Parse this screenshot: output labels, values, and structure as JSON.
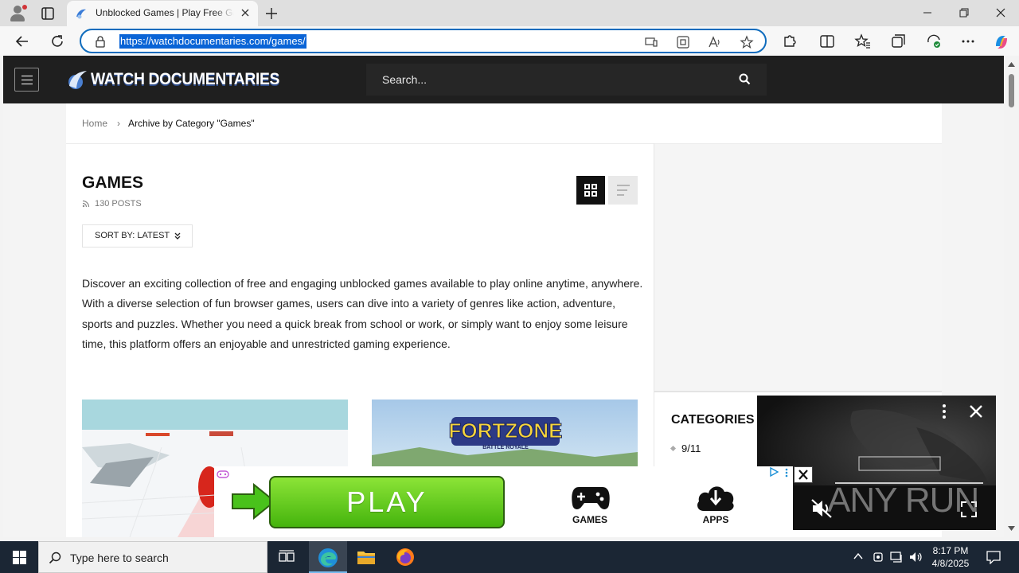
{
  "browser": {
    "tab_title": "Unblocked Games | Play Free Games",
    "url": "https://watchdocumentaries.com/games/"
  },
  "site": {
    "logo_text": "WATCH DOCUMENTARIES",
    "search_placeholder": "Search..."
  },
  "breadcrumb": {
    "home": "Home",
    "separator": "›",
    "current": "Archive by Category \"Games\""
  },
  "archive": {
    "title": "GAMES",
    "post_count": "130 POSTS",
    "sort_label": "SORT BY: LATEST",
    "description": "Discover an exciting collection of free and engaging unblocked games available to play online anytime, anywhere. With a diverse selection of fun browser games, users can dive into a variety of genres like action, adventure, sports and puzzles. Whether you need a quick break from school or work, or simply want to enjoy some leisure time, this platform offers an enjoyable and unrestricted gaming experience."
  },
  "cards": [
    {
      "image": "snow-racing-scene"
    },
    {
      "image": "fortzone-battle-royale",
      "logo_text": "FORTZONE",
      "logo_sub": "BATTLE ROYALE"
    }
  ],
  "sidebar": {
    "categories_title": "CATEGORIES",
    "first_category": "9/11"
  },
  "ad": {
    "play_label": "PLAY",
    "games_label": "GAMES",
    "apps_label": "APPS"
  },
  "watermark": "ANY RUN",
  "taskbar": {
    "search_placeholder": "Type here to search",
    "time": "8:17 PM",
    "date": "4/8/2025"
  },
  "colors": {
    "header_bg": "#1f1f1f",
    "accent_blue": "#0f6cbd",
    "play_green": "#45b40d",
    "taskbar": "#1b2634"
  }
}
